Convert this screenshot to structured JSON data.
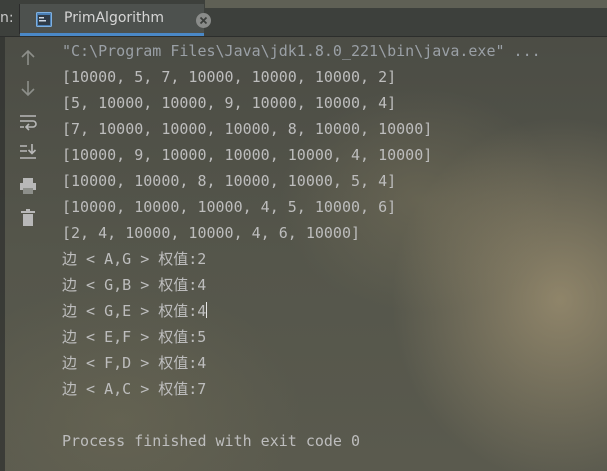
{
  "tabbar": {
    "stub_label": "n:",
    "tab_title": "PrimAlgorithm"
  },
  "toolbar": {
    "icons": [
      "up-arrow-icon",
      "down-arrow-icon",
      "soft-wrap-icon",
      "scroll-to-end-icon",
      "print-icon",
      "trash-icon"
    ]
  },
  "console": {
    "command": "\"C:\\Program Files\\Java\\jdk1.8.0_221\\bin\\java.exe\" ...",
    "matrix": [
      "[10000, 5, 7, 10000, 10000, 10000, 2]",
      "[5, 10000, 10000, 9, 10000, 10000, 4]",
      "[7, 10000, 10000, 10000, 8, 10000, 10000]",
      "[10000, 9, 10000, 10000, 10000, 4, 10000]",
      "[10000, 10000, 8, 10000, 10000, 5, 4]",
      "[10000, 10000, 10000, 4, 5, 10000, 6]",
      "[2, 4, 10000, 10000, 4, 6, 10000]"
    ],
    "edges": [
      "边 < A,G > 权值:2",
      "边 < G,B > 权值:4",
      "边 < G,E > 权值:4",
      "边 < E,F > 权值:5",
      "边 < F,D > 权值:4",
      "边 < A,C > 权值:7"
    ],
    "exit_message": "Process finished with exit code 0"
  },
  "colors": {
    "text": "#bdbdbd",
    "tab_underline": "#4a88c7",
    "background": "#4b4c44"
  }
}
